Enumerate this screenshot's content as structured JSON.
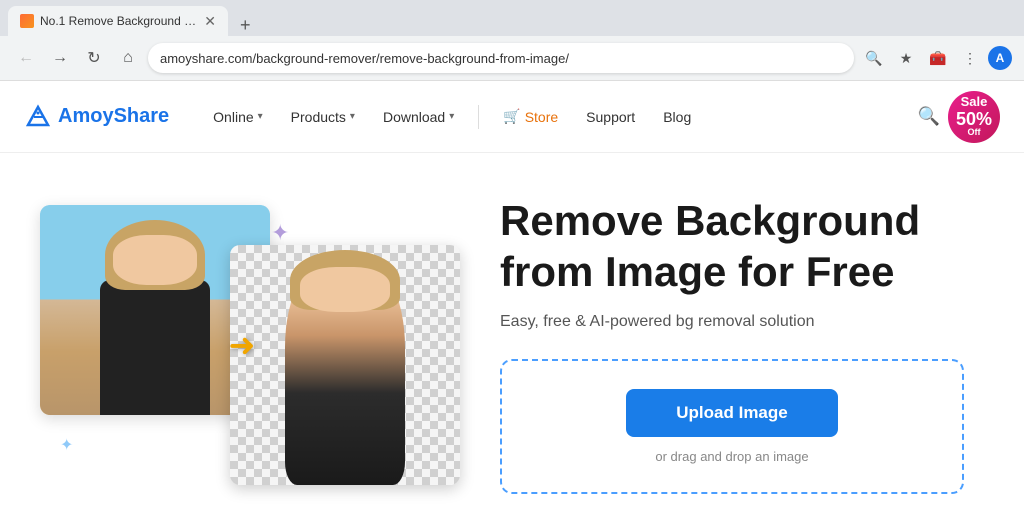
{
  "browser": {
    "tab": {
      "title": "No.1 Remove Background from...",
      "favicon_label": "tab-favicon"
    },
    "address": "amoyshare.com/background-remover/remove-background-from-image/",
    "new_tab_icon": "+"
  },
  "nav": {
    "logo_text_main": "Amoy",
    "logo_text_accent": "Share",
    "menu": {
      "online": "Online",
      "products": "Products",
      "download": "Download",
      "store": "Store",
      "support": "Support",
      "blog": "Blog"
    },
    "sale": {
      "label": "Sale",
      "percent": "50%",
      "sub": "Off"
    }
  },
  "hero": {
    "title": "Remove Background from Image for Free",
    "subtitle": "Easy, free & AI-powered bg removal solution",
    "upload_button": "Upload Image",
    "drag_hint": "or drag and drop an image"
  }
}
